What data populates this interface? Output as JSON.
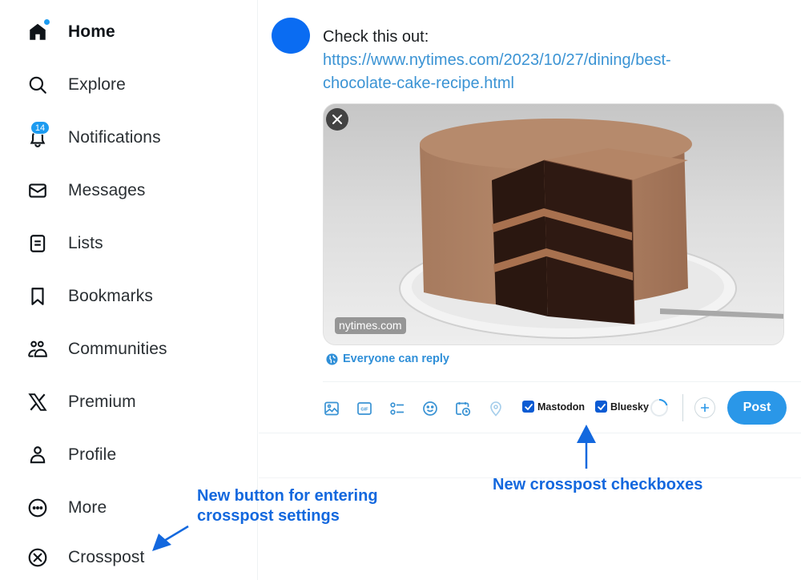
{
  "sidebar": {
    "items": [
      {
        "label": "Home",
        "icon": "home-icon",
        "active": true,
        "has_dot": true
      },
      {
        "label": "Explore",
        "icon": "search-icon"
      },
      {
        "label": "Notifications",
        "icon": "bell-icon",
        "badge": "14"
      },
      {
        "label": "Messages",
        "icon": "envelope-icon"
      },
      {
        "label": "Lists",
        "icon": "list-icon"
      },
      {
        "label": "Bookmarks",
        "icon": "bookmark-icon"
      },
      {
        "label": "Communities",
        "icon": "communities-icon"
      },
      {
        "label": "Premium",
        "icon": "x-logo-icon"
      },
      {
        "label": "Profile",
        "icon": "person-icon"
      },
      {
        "label": "More",
        "icon": "more-circle-icon"
      },
      {
        "label": "Crosspost",
        "icon": "crosspost-circle-x-icon"
      }
    ]
  },
  "composer": {
    "text": "Check this out:",
    "link_line1": "https://www.nytimes.com/2023/10/27/dining/best-",
    "link_line2": "chocolate-cake-recipe.html",
    "card": {
      "domain": "nytimes.com",
      "image_subject": "Chocolate layer cake with a slice removed on a white plate"
    },
    "reply_setting": "Everyone can reply",
    "toolbar": {
      "tools": [
        "image-icon",
        "gif-icon",
        "poll-icon",
        "emoji-icon",
        "schedule-icon",
        "location-icon"
      ]
    },
    "crosspost": {
      "mastodon": {
        "label": "Mastodon",
        "checked": true
      },
      "bluesky": {
        "label": "Bluesky",
        "checked": true
      }
    },
    "post_label": "Post"
  },
  "annotations": {
    "sidebar_note_line1": "New button for entering",
    "sidebar_note_line2": "crosspost settings",
    "checkbox_note": "New crosspost checkboxes"
  },
  "colors": {
    "accent": "#1d9bf0",
    "annotation": "#1368de",
    "checkbox": "#0b5bd3",
    "avatar": "#0a6cf2"
  }
}
